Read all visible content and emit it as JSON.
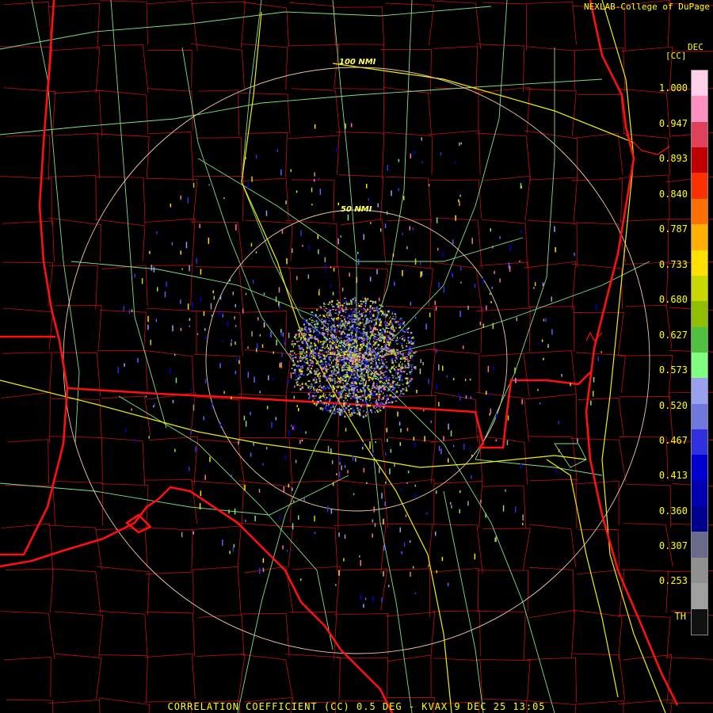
{
  "header": {
    "credit": "NEXLAB-College of DuPage",
    "month": "DEC",
    "unit": "[CC]"
  },
  "footer": {
    "title": "CORRELATION COEFFICIENT (CC) 0.5 DEG - KVAX 9 DEC 25 13:05"
  },
  "rings": {
    "inner_label": "50 NMI",
    "outer_label": "100 NMI"
  },
  "colorbar": {
    "labels": [
      "1.000",
      "0.947",
      "0.893",
      "0.840",
      "0.787",
      "0.733",
      "0.680",
      "0.627",
      "0.573",
      "0.520",
      "0.467",
      "0.413",
      "0.360",
      "0.307",
      "0.253",
      "TH"
    ],
    "colors": [
      "#ffd0e8",
      "#ff90c0",
      "#e0405a",
      "#c00000",
      "#ff3000",
      "#ff7000",
      "#ffb000",
      "#ffe000",
      "#c8d800",
      "#90c000",
      "#50c040",
      "#80ff80",
      "#9aa0f0",
      "#7078e0",
      "#3030e0",
      "#0000d0",
      "#0000b0",
      "#000090",
      "#6a6a8a",
      "#909090",
      "#a0a0a0",
      "#111111"
    ]
  },
  "colors": {
    "state_border": "#ff1010",
    "county_line": "#c01010",
    "highway": "#f0f000",
    "road": "#80e080",
    "range_ring": "#f0c8a0",
    "label": "#ffff00"
  },
  "icons": {
    "radar_site": "radar-site-marker"
  }
}
